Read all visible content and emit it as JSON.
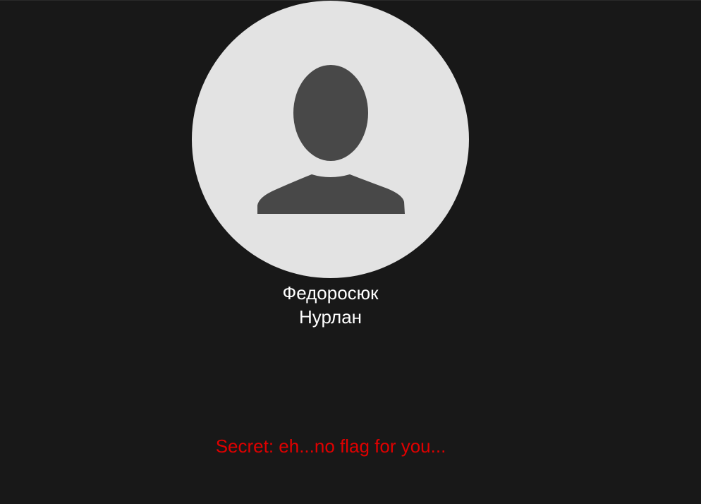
{
  "colors": {
    "background": "#181818",
    "avatar_circle": "#e3e3e3",
    "avatar_figure": "#484848",
    "name_text": "#ffffff",
    "secret_text": "#e00000"
  },
  "profile": {
    "avatar_icon": "default-user-silhouette",
    "last_name": "Федоросюк",
    "first_name": "Нурлан"
  },
  "secret": {
    "text": "Secret: eh...no flag for you..."
  }
}
